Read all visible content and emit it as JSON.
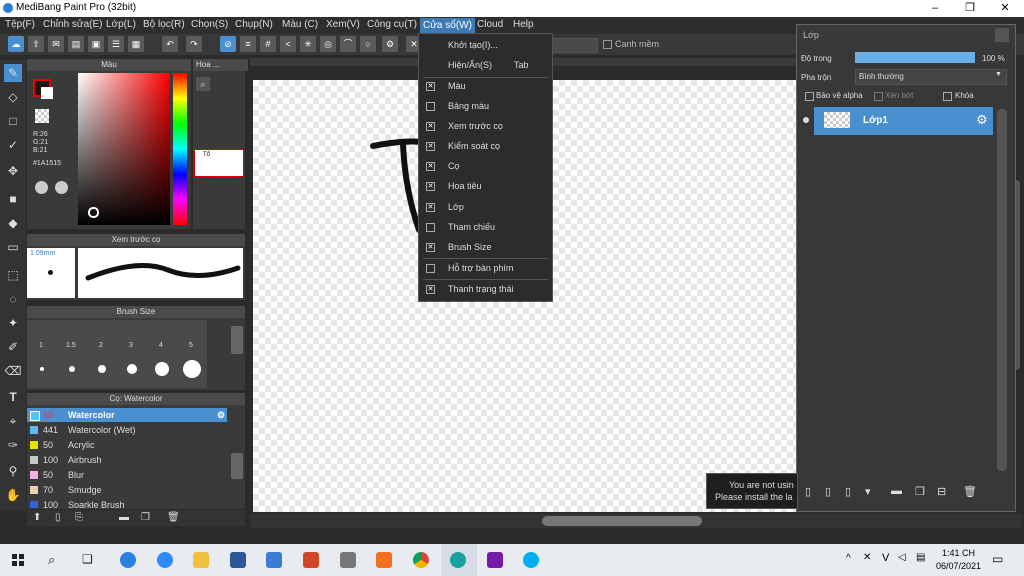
{
  "window": {
    "title": "MediBang Paint Pro (32bit)",
    "minimize": "–",
    "maximize": "❐",
    "close": "✕"
  },
  "menu": [
    "Tệp(F)",
    "Chỉnh sửa(E)",
    "Lớp(L)",
    "Bộ lọc(R)",
    "Chọn(S)",
    "Chụp(N)",
    "Màu (C)",
    "Xem(V)",
    "Công cụ(T)",
    "Cửa sổ(W)",
    "Cloud",
    "Help"
  ],
  "toolbar": {
    "antialias_label": "Canh mềm"
  },
  "color_panel": {
    "title": "Màu",
    "r": "R:26",
    "g": "G:21",
    "b": "B:21",
    "hex": "#1A1515",
    "fg_color": "#1A1515"
  },
  "navigator_panel": {
    "title": "Hoa ...",
    "text": "Tổ"
  },
  "brush_preview": {
    "title": "Xem trước cọ",
    "size": "1.09mm"
  },
  "brush_size": {
    "title": "Brush Size",
    "sizes": [
      "1",
      "1.5",
      "2",
      "3",
      "4",
      "5"
    ]
  },
  "brush_list": {
    "title": "Cọ: Watercolor",
    "items": [
      {
        "size": "15",
        "name": "Watercolor",
        "color": "#5bc0f0",
        "selected": true
      },
      {
        "size": "441",
        "name": "Watercolor (Wet)",
        "color": "#5bc0f0"
      },
      {
        "size": "50",
        "name": "Acrylic",
        "color": "#e8e000"
      },
      {
        "size": "100",
        "name": "Airbrush",
        "color": "#c8c8c8"
      },
      {
        "size": "50",
        "name": "Blur",
        "color": "#f0b0e0"
      },
      {
        "size": "70",
        "name": "Smudge",
        "color": "#f0d0b0"
      },
      {
        "size": "100",
        "name": "Sparkle Brush",
        "color": "#3060e0"
      }
    ]
  },
  "window_menu": {
    "items": [
      {
        "label": "Khởi tạo(I)...",
        "shortcut": "",
        "check": "none"
      },
      {
        "label": "Hiện/Ẩn(S)",
        "shortcut": "Tab",
        "check": "none"
      },
      {
        "label": "Màu",
        "check": "on"
      },
      {
        "label": "Bảng màu",
        "check": "off"
      },
      {
        "label": "Xem trước cọ",
        "check": "on"
      },
      {
        "label": "Kiểm soát cọ",
        "check": "on"
      },
      {
        "label": "Cọ",
        "check": "on"
      },
      {
        "label": "Hoa tiêu",
        "check": "on"
      },
      {
        "label": "Lớp",
        "check": "on"
      },
      {
        "label": "Tham chiếu",
        "check": "off"
      },
      {
        "label": "Brush Size",
        "check": "on"
      },
      {
        "label": "Hỗ trợ bàn phím",
        "check": "off"
      },
      {
        "label": "Thanh trạng thái",
        "check": "on"
      }
    ]
  },
  "layer_panel": {
    "title": "Lớp",
    "opacity_label": "Độ trong",
    "opacity_value": "100 %",
    "opacity": 1.0,
    "blend_label": "Pha trộn",
    "blend_value": "Bình thường",
    "protect_alpha": "Bảo vệ alpha",
    "clipping": "Xén bớt",
    "lock": "Khóa",
    "layer_name": "Lớp1"
  },
  "notice": {
    "line1": "You are not usin",
    "line2": "Please install the la"
  },
  "taskbar": {
    "time": "1:41 CH",
    "date": "06/07/2021",
    "lang": "V"
  },
  "colors": {
    "accent": "#3d7ab8",
    "layer_selected": "#4a8fd0",
    "panel_bg": "#3a3a3a"
  }
}
